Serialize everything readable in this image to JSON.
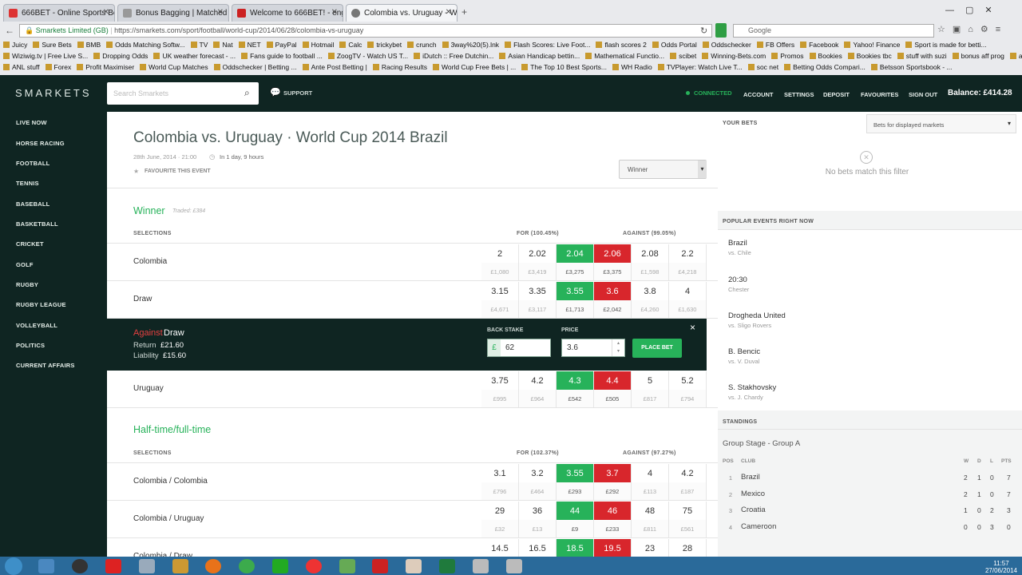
{
  "browser": {
    "tabs": [
      {
        "title": "666BET - Online Sports Bet..."
      },
      {
        "title": "Bonus Bagging | Matched ..."
      },
      {
        "title": "Welcome to 666BET! - engl..."
      },
      {
        "title": "Colombia vs. Uruguay - W..."
      }
    ],
    "cert": "Smarkets Limited (GB)",
    "url": "https://smarkets.com/sport/football/world-cup/2014/06/28/colombia-vs-uruguay",
    "search_placeholder": "Google",
    "bookmarks_row1": [
      "Juicy",
      "Sure Bets",
      "BMB",
      "Odds Matching Softw...",
      "TV",
      "Nat",
      "NET",
      "PayPal",
      "Hotmail",
      "Calc",
      "trickybet",
      "crunch",
      "3way%20(5).lnk",
      "Flash Scores: Live Foot...",
      "flash scores 2",
      "Odds Portal",
      "Oddschecker",
      "FB Offers",
      "Facebook",
      "Yahoo! Finance",
      "Sport is made for betti..."
    ],
    "bookmarks_row2": [
      "Wiziwig.tv | Free Live S...",
      "Dropping Odds",
      "UK weather forecast - ...",
      "Fans guide to football ...",
      "ZoogTV - Watch US T...",
      "iDutch :: Free Dutchin...",
      "Asian Handicap bettin...",
      "Mathematical Functio...",
      "scibet",
      "Winning-Bets.com",
      "Promos",
      "Bookies",
      "Bookies tbc",
      "stuff with suzi",
      "bonus aff prog",
      "aff"
    ],
    "bookmarks_row3": [
      "ANL stuff",
      "Forex",
      "Profit Maximiser",
      "World Cup Matches",
      "Oddschecker | Betting ...",
      "Ante Post Betting |",
      "Racing Results",
      "World Cup Free Bets | ...",
      "The Top 10 Best Sports...",
      "WH Radio",
      "TVPlayer: Watch Live T...",
      "soc net",
      "Betting Odds Compari...",
      "Betsson Sportsbook - ..."
    ]
  },
  "header": {
    "logo": "SMARKETS",
    "search_placeholder": "Search Smarkets",
    "support": "SUPPORT",
    "connected": "CONNECTED",
    "nav": [
      "ACCOUNT",
      "SETTINGS",
      "DEPOSIT",
      "FAVOURITES",
      "SIGN OUT"
    ],
    "balance": "Balance: £414.28"
  },
  "sidebar": {
    "items": [
      "LIVE NOW",
      "HORSE RACING",
      "FOOTBALL",
      "TENNIS",
      "BASEBALL",
      "BASKETBALL",
      "CRICKET",
      "GOLF",
      "RUGBY",
      "RUGBY LEAGUE",
      "VOLLEYBALL",
      "POLITICS",
      "CURRENT AFFAIRS"
    ]
  },
  "event": {
    "title": "Colombia vs. Uruguay · World Cup 2014 Brazil",
    "date": "28th June, 2014 · 21:00",
    "countdown": "In 1 day, 9 hours",
    "favourite": "FAVOURITE THIS EVENT",
    "market_select": "Winner"
  },
  "winner_market": {
    "title": "Winner",
    "traded": "Traded: £384",
    "selections_label": "SELECTIONS",
    "for_label": "FOR (100.45%)",
    "against_label": "AGAINST (99.05%)",
    "rows": [
      {
        "name": "Colombia",
        "prices": [
          "2",
          "2.02",
          "2.04",
          "2.06",
          "2.08",
          "2.2"
        ],
        "volumes": [
          "£1,080",
          "£3,419",
          "£3,275",
          "£3,375",
          "£1,598",
          "£4,218"
        ]
      },
      {
        "name": "Draw",
        "prices": [
          "3.15",
          "3.35",
          "3.55",
          "3.6",
          "3.8",
          "4"
        ],
        "volumes": [
          "£4,671",
          "£3,117",
          "£1,713",
          "£2,042",
          "£4,260",
          "£1,630"
        ]
      },
      {
        "name": "Uruguay",
        "prices": [
          "3.75",
          "4.2",
          "4.3",
          "4.4",
          "5",
          "5.2"
        ],
        "volumes": [
          "£995",
          "£964",
          "£542",
          "£505",
          "£817",
          "£794"
        ]
      }
    ]
  },
  "betslip": {
    "side": "Against",
    "selection": "Draw",
    "return_label": "Return",
    "return_value": "£21.60",
    "liability_label": "Liability",
    "liability_value": "£15.60",
    "stake_label": "BACK STAKE",
    "currency": "£",
    "stake_value": "62",
    "price_label": "PRICE",
    "price_value": "3.6",
    "place_bet": "PLACE BET",
    "close": "×"
  },
  "htft_market": {
    "title": "Half-time/full-time",
    "selections_label": "SELECTIONS",
    "for_label": "FOR (102.37%)",
    "against_label": "AGAINST (97.27%)",
    "rows": [
      {
        "name": "Colombia / Colombia",
        "prices": [
          "3.1",
          "3.2",
          "3.55",
          "3.7",
          "4",
          "4.2"
        ],
        "volumes": [
          "£796",
          "£464",
          "£293",
          "£292",
          "£113",
          "£187"
        ]
      },
      {
        "name": "Colombia / Uruguay",
        "prices": [
          "29",
          "36",
          "44",
          "46",
          "48",
          "75"
        ],
        "volumes": [
          "£32",
          "£13",
          "£9",
          "£233",
          "£811",
          "£561"
        ]
      },
      {
        "name": "Colombia / Draw",
        "prices": [
          "14.5",
          "16.5",
          "18.5",
          "19.5",
          "23",
          "28"
        ],
        "volumes": []
      }
    ]
  },
  "your_bets": {
    "title": "YOUR BETS",
    "filter": "Bets for displayed markets",
    "empty": "No bets match this filter"
  },
  "popular": {
    "title": "POPULAR EVENTS RIGHT NOW",
    "events": [
      {
        "name": "Brazil",
        "sub": "vs. Chile"
      },
      {
        "name": "20:30",
        "sub": "Chester"
      },
      {
        "name": "Drogheda United",
        "sub": "vs. Sligo Rovers"
      },
      {
        "name": "B. Bencic",
        "sub": "vs. V. Duval"
      },
      {
        "name": "S. Stakhovsky",
        "sub": "vs. J. Chardy"
      }
    ]
  },
  "standings": {
    "title": "STANDINGS",
    "group": "Group Stage - Group A",
    "cols": [
      "POS",
      "CLUB",
      "W",
      "D",
      "L",
      "PTS"
    ],
    "rows": [
      {
        "pos": "1",
        "club": "Brazil",
        "w": "2",
        "d": "1",
        "l": "0",
        "pts": "7"
      },
      {
        "pos": "2",
        "club": "Mexico",
        "w": "2",
        "d": "1",
        "l": "0",
        "pts": "7"
      },
      {
        "pos": "3",
        "club": "Croatia",
        "w": "1",
        "d": "0",
        "l": "2",
        "pts": "3"
      },
      {
        "pos": "4",
        "club": "Cameroon",
        "w": "0",
        "d": "0",
        "l": "3",
        "pts": "0"
      }
    ]
  },
  "taskbar": {
    "time": "11:57",
    "date": "27/06/2014"
  },
  "colors": {
    "back": "#27b25a",
    "lay": "#d8262c",
    "accent": "#27b25a",
    "dark": "#0f2522"
  }
}
